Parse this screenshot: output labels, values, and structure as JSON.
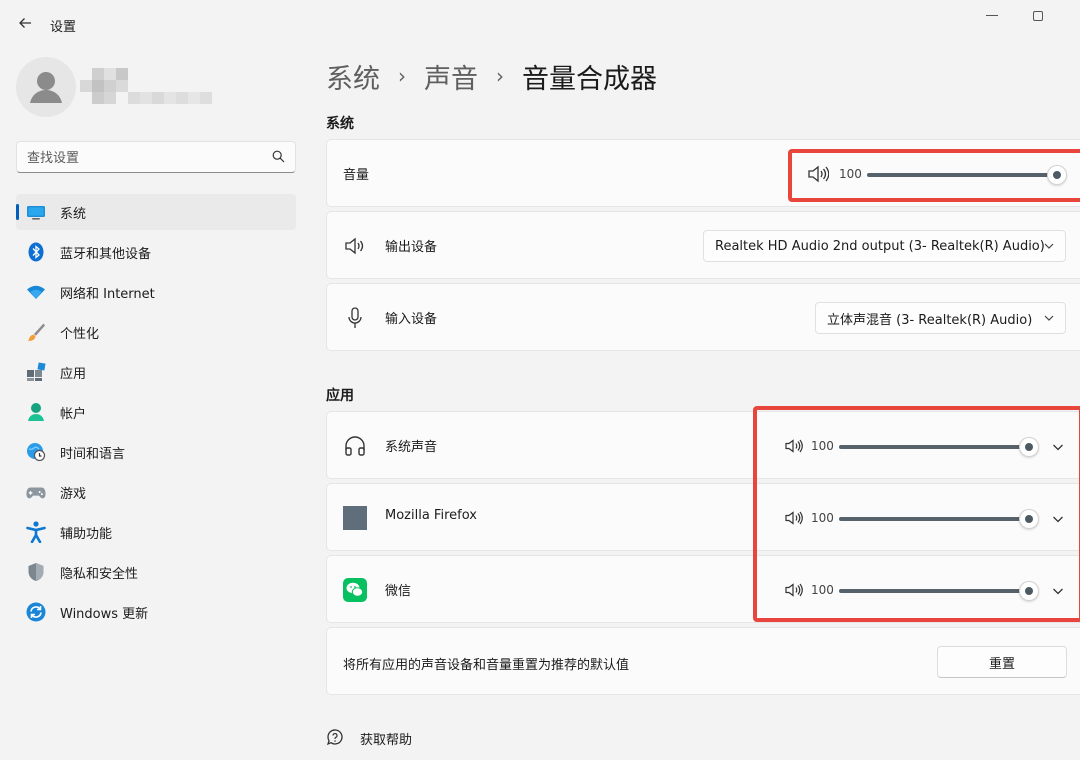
{
  "window": {
    "title": "设置"
  },
  "search": {
    "placeholder": "查找设置"
  },
  "sidebar": {
    "items": [
      {
        "label": "系统",
        "icon": "monitor-icon",
        "active": true
      },
      {
        "label": "蓝牙和其他设备",
        "icon": "bluetooth-icon"
      },
      {
        "label": "网络和 Internet",
        "icon": "wifi-icon"
      },
      {
        "label": "个性化",
        "icon": "brush-icon"
      },
      {
        "label": "应用",
        "icon": "apps-icon"
      },
      {
        "label": "帐户",
        "icon": "account-icon"
      },
      {
        "label": "时间和语言",
        "icon": "globe-clock-icon"
      },
      {
        "label": "游戏",
        "icon": "gamepad-icon"
      },
      {
        "label": "辅助功能",
        "icon": "accessibility-icon"
      },
      {
        "label": "隐私和安全性",
        "icon": "shield-icon"
      },
      {
        "label": "Windows 更新",
        "icon": "update-icon"
      }
    ]
  },
  "breadcrumb": {
    "items": [
      "系统",
      "声音",
      "音量合成器"
    ]
  },
  "system_section": {
    "title": "系统",
    "volume": {
      "label": "音量",
      "value": "100"
    },
    "output": {
      "label": "输出设备",
      "value": "Realtek HD Audio 2nd output (3- Realtek(R) Audio)"
    },
    "input": {
      "label": "输入设备",
      "value": "立体声混音 (3- Realtek(R) Audio)"
    }
  },
  "apps_section": {
    "title": "应用",
    "apps": [
      {
        "name": "系统声音",
        "icon": "headphones-icon",
        "volume": "100"
      },
      {
        "name": "Mozilla Firefox",
        "icon": "firefox-placeholder-icon",
        "volume": "100"
      },
      {
        "name": "微信",
        "icon": "wechat-icon",
        "volume": "100"
      }
    ]
  },
  "reset": {
    "text": "将所有应用的声音设备和音量重置为推荐的默认值",
    "button": "重置"
  },
  "help": {
    "label": "获取帮助"
  },
  "colors": {
    "accent": "#005fb8",
    "highlight": "#e8453c",
    "slider": "#55626c",
    "wechat": "#07c160"
  }
}
